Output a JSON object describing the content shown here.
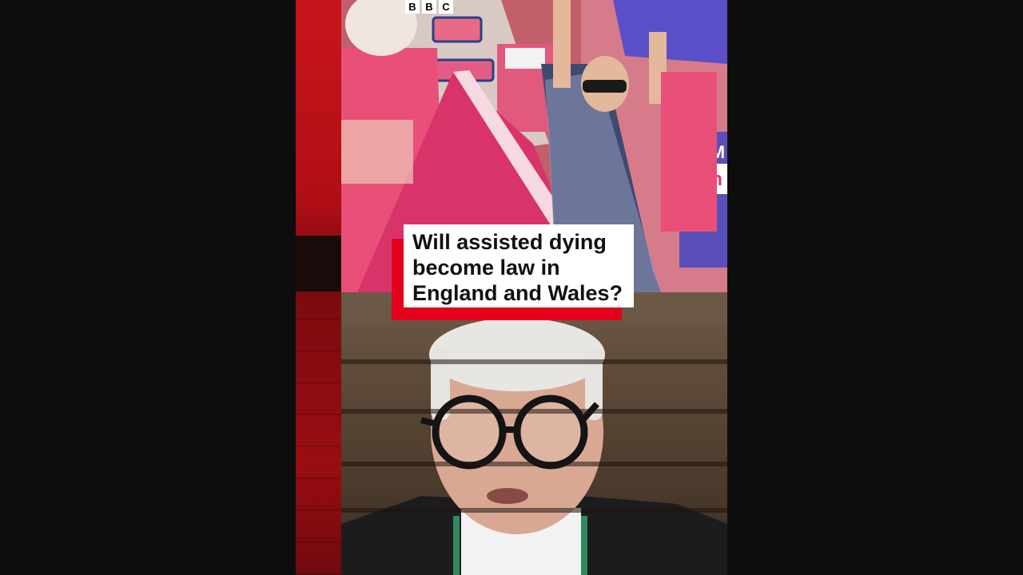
{
  "logo": {
    "letters": [
      "B",
      "B",
      "C"
    ]
  },
  "headline": {
    "line1": "Will assisted dying",
    "line2": "become law in",
    "line3": "England and Wales?"
  },
  "colors": {
    "accent_red": "#e3001b",
    "caption_bg": "#ffffff",
    "background": "#0d0d0d"
  }
}
